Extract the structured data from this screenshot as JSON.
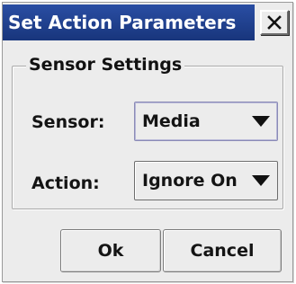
{
  "window": {
    "title": "Set Action Parameters",
    "close_label": "X"
  },
  "group": {
    "legend": "Sensor Settings"
  },
  "fields": {
    "sensor": {
      "label": "Sensor:",
      "value": "Media"
    },
    "action": {
      "label": "Action:",
      "value": "Ignore On"
    }
  },
  "buttons": {
    "ok": "Ok",
    "cancel": "Cancel"
  },
  "icons": {
    "close": "close-icon",
    "dropdown": "triangle-down-icon"
  },
  "colors": {
    "title_bar": "#1f3d8c",
    "title_text": "#ffffff",
    "dialog_bg": "#ececec"
  }
}
